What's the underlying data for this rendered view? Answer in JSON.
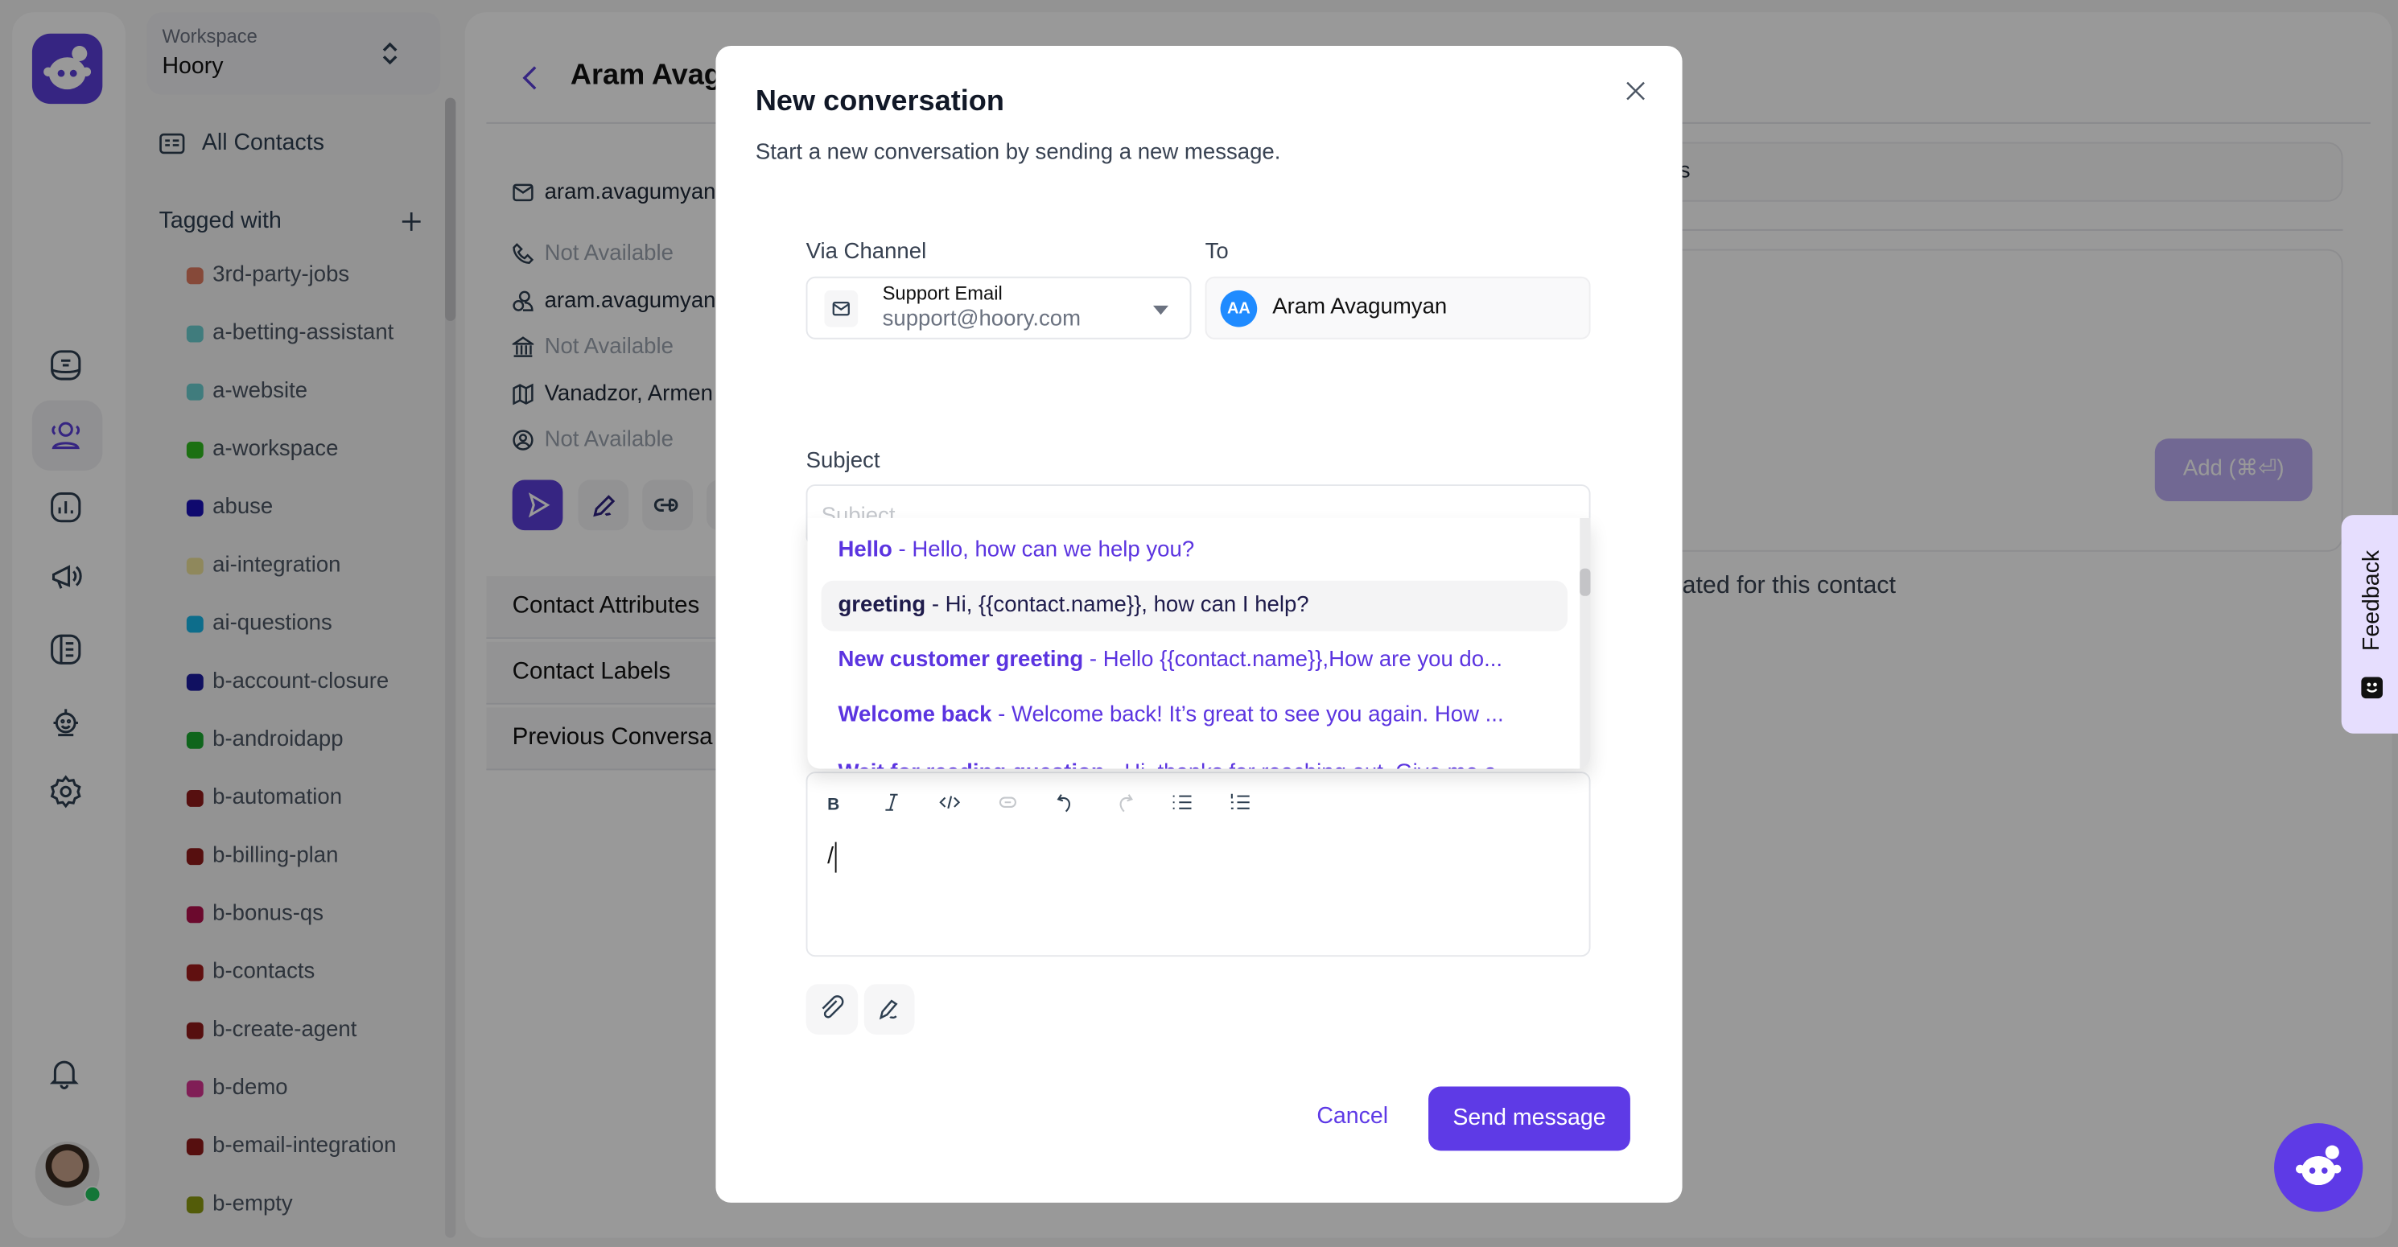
{
  "workspace": {
    "label": "Workspace",
    "name": "Hoory"
  },
  "sidebar": {
    "all_contacts": "All Contacts",
    "tagged_with": "Tagged with",
    "tags": [
      {
        "label": "3rd-party-jobs",
        "color": "#e07b5f"
      },
      {
        "label": "a-betting-assistant",
        "color": "#6bcfd0"
      },
      {
        "label": "a-website",
        "color": "#6bcfd0"
      },
      {
        "label": "a-workspace",
        "color": "#2fbb1e"
      },
      {
        "label": "abuse",
        "color": "#1a10b8"
      },
      {
        "label": "ai-integration",
        "color": "#efe39a"
      },
      {
        "label": "ai-questions",
        "color": "#16b6e8"
      },
      {
        "label": "b-account-closure",
        "color": "#1c1ca0"
      },
      {
        "label": "b-androidapp",
        "color": "#1aa830"
      },
      {
        "label": "b-automation",
        "color": "#8f1a1a"
      },
      {
        "label": "b-billing-plan",
        "color": "#8f1a1a"
      },
      {
        "label": "b-bonus-qs",
        "color": "#b3104c"
      },
      {
        "label": "b-contacts",
        "color": "#a01c1c"
      },
      {
        "label": "b-create-agent",
        "color": "#8f1a1a"
      },
      {
        "label": "b-demo",
        "color": "#d5328f"
      },
      {
        "label": "b-email-integration",
        "color": "#8f1a1a"
      },
      {
        "label": "b-empty",
        "color": "#8a9a10"
      }
    ]
  },
  "contact": {
    "name": "Aram Avag",
    "email": "aram.avagumyan",
    "phone": "Not Available",
    "username": "aram.avagumyan",
    "company": "Not Available",
    "location": "Vanadzor, Armen",
    "social": "Not Available",
    "sections": [
      "Contact Attributes",
      "Contact Labels",
      "Previous Conversa"
    ]
  },
  "notes": {
    "tab_tail": "s",
    "add_button": "Add (⌘⏎)",
    "empty_tail": "ated for this contact"
  },
  "feedback": {
    "label": "Feedback"
  },
  "modal": {
    "title": "New conversation",
    "subtitle": "Start a new conversation by sending a new message.",
    "via_channel_label": "Via Channel",
    "channel_name": "Support Email",
    "channel_email": "support@hoory.com",
    "to_label": "To",
    "to_initials": "AA",
    "to_name": "Aram Avagumyan",
    "subject_label": "Subject",
    "subject_placeholder": "Subject",
    "canned_responses": [
      {
        "short": "Hello",
        "text": "Hello, how can we help you?"
      },
      {
        "short": "greeting",
        "text": "Hi, {{contact.name}}, how can I help?",
        "highlighted": true
      },
      {
        "short": "New customer greeting",
        "text": "Hello {{contact.name}},How are you do..."
      },
      {
        "short": "Welcome back",
        "text": "Welcome back! It’s great to see you again. How ..."
      },
      {
        "short": "Wait for reading question",
        "text": "Hi, thanks for reaching out. Give me a..."
      }
    ],
    "message_value": "/",
    "cancel": "Cancel",
    "send": "Send message"
  },
  "colors": {
    "accent": "#5e3ae6",
    "avatar_blue": "#1f8bff",
    "online": "#22c55e"
  }
}
